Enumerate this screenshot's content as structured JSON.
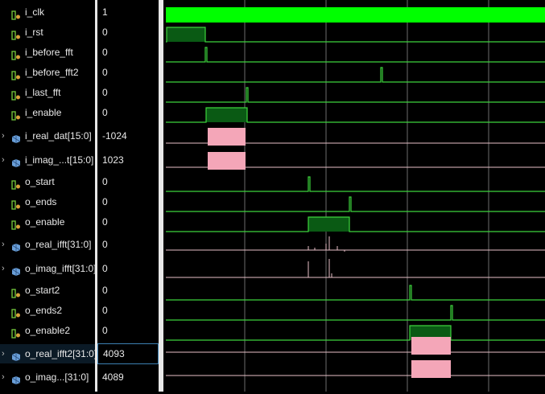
{
  "signals": [
    {
      "name": "i_clk",
      "value": "1",
      "kind": "bit",
      "expandable": false
    },
    {
      "name": "i_rst",
      "value": "0",
      "kind": "bit",
      "expandable": false
    },
    {
      "name": "i_before_fft",
      "value": "0",
      "kind": "bit",
      "expandable": false
    },
    {
      "name": "i_before_fft2",
      "value": "0",
      "kind": "bit",
      "expandable": false
    },
    {
      "name": "i_last_fft",
      "value": "0",
      "kind": "bit",
      "expandable": false
    },
    {
      "name": "i_enable",
      "value": "0",
      "kind": "bit",
      "expandable": false
    },
    {
      "name": "i_real_dat[15:0]",
      "value": "-1024",
      "kind": "bus",
      "expandable": true
    },
    {
      "name": "i_imag_...t[15:0]",
      "value": "1023",
      "kind": "bus",
      "expandable": true
    },
    {
      "name": "o_start",
      "value": "0",
      "kind": "bit",
      "expandable": false
    },
    {
      "name": "o_ends",
      "value": "0",
      "kind": "bit",
      "expandable": false
    },
    {
      "name": "o_enable",
      "value": "0",
      "kind": "bit",
      "expandable": false
    },
    {
      "name": "o_real_ifft[31:0]",
      "value": "0",
      "kind": "bus",
      "expandable": true
    },
    {
      "name": "o_imag_ifft[31:0]",
      "value": "0",
      "kind": "bus",
      "expandable": true
    },
    {
      "name": "o_start2",
      "value": "0",
      "kind": "bit",
      "expandable": false
    },
    {
      "name": "o_ends2",
      "value": "0",
      "kind": "bit",
      "expandable": false
    },
    {
      "name": "o_enable2",
      "value": "0",
      "kind": "bit",
      "expandable": false
    },
    {
      "name": "o_real_ifft2[31:0]",
      "value": "4093",
      "kind": "bus",
      "expandable": true,
      "selected": true
    },
    {
      "name": "o_imag...[31:0]",
      "value": "4089",
      "kind": "bus",
      "expandable": true
    }
  ],
  "colors": {
    "bit_wave": "#3dd43d",
    "bit_high_fill": "#0a5a14",
    "clk_fill": "#00ff00",
    "bus_wave": "#f4a6b8",
    "bus_line": "#e8c0c8",
    "grid": "#6b6b6b",
    "panel_separator": "#e8e8e8",
    "selection": "#3c7fb1",
    "icon_bit": "#6fbf3a",
    "icon_bus": "#6a9fd8"
  },
  "icons": {
    "bit_signal": "bit-signal-icon",
    "bus_signal": "bus-signal-icon",
    "expand": "chevron-right-icon"
  }
}
